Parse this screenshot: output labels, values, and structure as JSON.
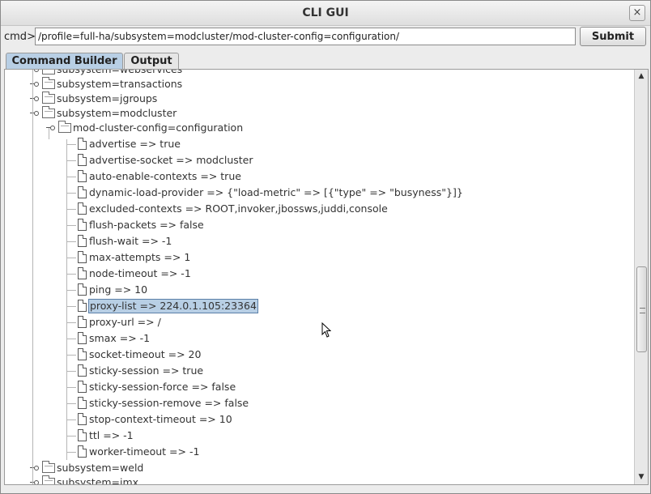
{
  "window": {
    "title": "CLI GUI",
    "close_icon": "×"
  },
  "command": {
    "label": "cmd>",
    "value": "/profile=full-ha/subsystem=modcluster/mod-cluster-config=configuration/",
    "submit_label": "Submit"
  },
  "tabs": [
    {
      "label": "Command Builder",
      "active": true
    },
    {
      "label": "Output",
      "active": false
    }
  ],
  "tree": {
    "nodes": [
      {
        "label": "subsystem=webservices",
        "type": "folder",
        "depth": 0
      },
      {
        "label": "subsystem=transactions",
        "type": "folder",
        "depth": 0
      },
      {
        "label": "subsystem=jgroups",
        "type": "folder",
        "depth": 0
      },
      {
        "label": "subsystem=modcluster",
        "type": "folder",
        "depth": 0
      },
      {
        "label": "mod-cluster-config=configuration",
        "type": "folder",
        "depth": 1
      },
      {
        "label": "advertise => true",
        "type": "file",
        "depth": 2
      },
      {
        "label": "advertise-socket => modcluster",
        "type": "file",
        "depth": 2
      },
      {
        "label": "auto-enable-contexts => true",
        "type": "file",
        "depth": 2
      },
      {
        "label": "dynamic-load-provider => {\"load-metric\" => [{\"type\" => \"busyness\"}]}",
        "type": "file",
        "depth": 2
      },
      {
        "label": "excluded-contexts => ROOT,invoker,jbossws,juddi,console",
        "type": "file",
        "depth": 2
      },
      {
        "label": "flush-packets => false",
        "type": "file",
        "depth": 2
      },
      {
        "label": "flush-wait => -1",
        "type": "file",
        "depth": 2
      },
      {
        "label": "max-attempts => 1",
        "type": "file",
        "depth": 2
      },
      {
        "label": "node-timeout => -1",
        "type": "file",
        "depth": 2
      },
      {
        "label": "ping => 10",
        "type": "file",
        "depth": 2
      },
      {
        "label": "proxy-list => 224.0.1.105:23364",
        "type": "file",
        "depth": 2,
        "selected": true
      },
      {
        "label": "proxy-url => /",
        "type": "file",
        "depth": 2
      },
      {
        "label": "smax => -1",
        "type": "file",
        "depth": 2
      },
      {
        "label": "socket-timeout => 20",
        "type": "file",
        "depth": 2
      },
      {
        "label": "sticky-session => true",
        "type": "file",
        "depth": 2
      },
      {
        "label": "sticky-session-force => false",
        "type": "file",
        "depth": 2
      },
      {
        "label": "sticky-session-remove => false",
        "type": "file",
        "depth": 2
      },
      {
        "label": "stop-context-timeout => 10",
        "type": "file",
        "depth": 2
      },
      {
        "label": "ttl => -1",
        "type": "file",
        "depth": 2
      },
      {
        "label": "worker-timeout => -1",
        "type": "file",
        "depth": 2
      },
      {
        "label": "subsystem=weld",
        "type": "folder",
        "depth": 0
      },
      {
        "label": "subsystem=jmx",
        "type": "folder",
        "depth": 0
      }
    ]
  },
  "scrollbar": {
    "up_icon": "▲",
    "down_icon": "▼",
    "position": 0.55
  },
  "colors": {
    "selection": "#b8cfe5",
    "selection_border": "#5b7fa8",
    "active_tab": "#b8cfe5"
  }
}
